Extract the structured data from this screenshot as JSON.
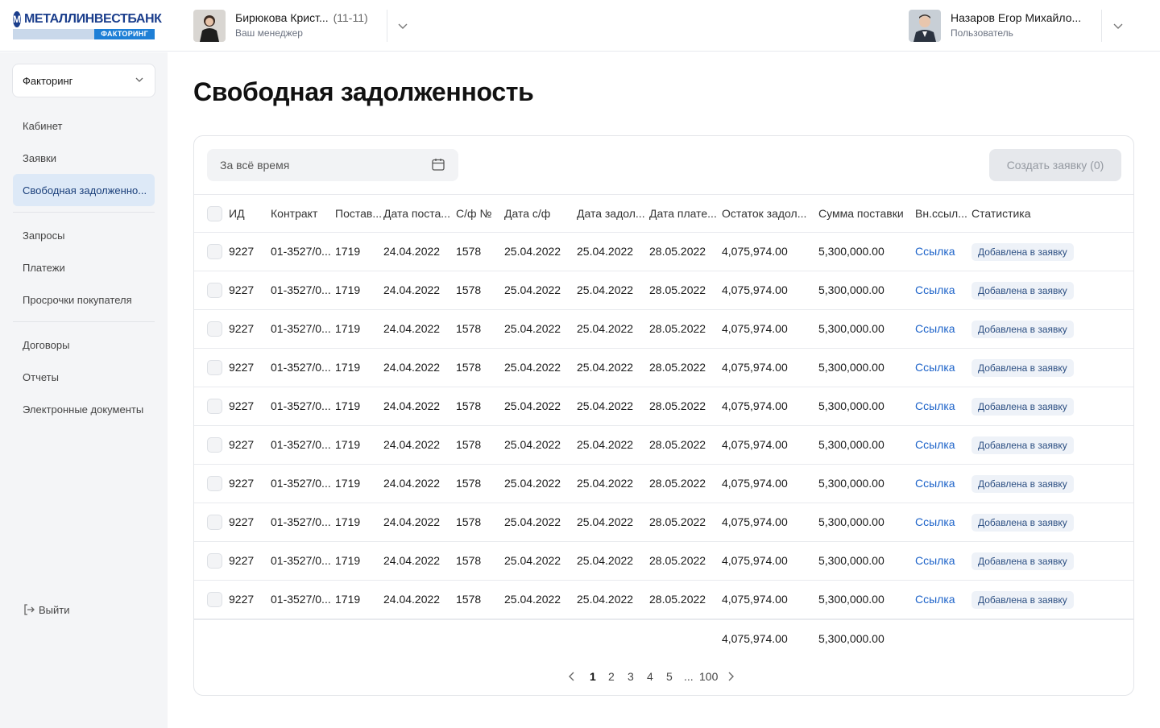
{
  "brand": {
    "name": "МЕТАЛЛИНВЕСТБАНК",
    "sub": "ФАКТОРИНГ",
    "mark": "М",
    "colors": {
      "primary": "#1b3e8c",
      "accent": "#1e7fd6",
      "active_bg": "#dde9f7",
      "link": "#1d63c9"
    }
  },
  "manager": {
    "name": "Бирюкова Крист...",
    "code": "(11-11)",
    "role": "Ваш менеджер"
  },
  "user": {
    "name": "Назаров Егор Михайло...",
    "role": "Пользователь"
  },
  "sidebar": {
    "product_select": "Факторинг",
    "items": [
      {
        "label": "Кабинет"
      },
      {
        "label": "Заявки"
      },
      {
        "label": "Свободная задолженно...",
        "active": true
      },
      {
        "label": "Запросы"
      },
      {
        "label": "Платежи"
      },
      {
        "label": "Просрочки покупателя"
      },
      {
        "label": "Договоры"
      },
      {
        "label": "Отчеты"
      },
      {
        "label": "Электронные документы"
      }
    ],
    "logout": "Выйти"
  },
  "page": {
    "title": "Свободная задолженность"
  },
  "filters": {
    "date_placeholder": "За всё время",
    "create_button": "Создать заявку (0)"
  },
  "table": {
    "headers": {
      "id": "ИД",
      "contract": "Контракт",
      "supplier": "Постав...",
      "delivery_date": "Дата поста...",
      "invoice_no": "С/ф №",
      "invoice_date": "Дата с/ф",
      "debt_date": "Дата задол...",
      "payment_date": "Дата плате...",
      "debt_balance": "Остаток задол...",
      "delivery_sum": "Сумма поставки",
      "ext_link": "Вн.ссыл...",
      "statistics": "Статистика"
    },
    "rows": [
      {
        "id": "9227",
        "contract": "01-3527/0...",
        "supplier": "1719",
        "delivery_date": "24.04.2022",
        "invoice_no": "1578",
        "invoice_date": "25.04.2022",
        "debt_date": "25.04.2022",
        "payment_date": "28.05.2022",
        "debt_balance": "4,075,974.00",
        "delivery_sum": "5,300,000.00",
        "ext_link": "Ссылка",
        "statistics": "Добавлена в заявку"
      },
      {
        "id": "9227",
        "contract": "01-3527/0...",
        "supplier": "1719",
        "delivery_date": "24.04.2022",
        "invoice_no": "1578",
        "invoice_date": "25.04.2022",
        "debt_date": "25.04.2022",
        "payment_date": "28.05.2022",
        "debt_balance": "4,075,974.00",
        "delivery_sum": "5,300,000.00",
        "ext_link": "Ссылка",
        "statistics": "Добавлена в заявку"
      },
      {
        "id": "9227",
        "contract": "01-3527/0...",
        "supplier": "1719",
        "delivery_date": "24.04.2022",
        "invoice_no": "1578",
        "invoice_date": "25.04.2022",
        "debt_date": "25.04.2022",
        "payment_date": "28.05.2022",
        "debt_balance": "4,075,974.00",
        "delivery_sum": "5,300,000.00",
        "ext_link": "Ссылка",
        "statistics": "Добавлена в заявку"
      },
      {
        "id": "9227",
        "contract": "01-3527/0...",
        "supplier": "1719",
        "delivery_date": "24.04.2022",
        "invoice_no": "1578",
        "invoice_date": "25.04.2022",
        "debt_date": "25.04.2022",
        "payment_date": "28.05.2022",
        "debt_balance": "4,075,974.00",
        "delivery_sum": "5,300,000.00",
        "ext_link": "Ссылка",
        "statistics": "Добавлена в заявку"
      },
      {
        "id": "9227",
        "contract": "01-3527/0...",
        "supplier": "1719",
        "delivery_date": "24.04.2022",
        "invoice_no": "1578",
        "invoice_date": "25.04.2022",
        "debt_date": "25.04.2022",
        "payment_date": "28.05.2022",
        "debt_balance": "4,075,974.00",
        "delivery_sum": "5,300,000.00",
        "ext_link": "Ссылка",
        "statistics": "Добавлена в заявку"
      },
      {
        "id": "9227",
        "contract": "01-3527/0...",
        "supplier": "1719",
        "delivery_date": "24.04.2022",
        "invoice_no": "1578",
        "invoice_date": "25.04.2022",
        "debt_date": "25.04.2022",
        "payment_date": "28.05.2022",
        "debt_balance": "4,075,974.00",
        "delivery_sum": "5,300,000.00",
        "ext_link": "Ссылка",
        "statistics": "Добавлена в заявку"
      },
      {
        "id": "9227",
        "contract": "01-3527/0...",
        "supplier": "1719",
        "delivery_date": "24.04.2022",
        "invoice_no": "1578",
        "invoice_date": "25.04.2022",
        "debt_date": "25.04.2022",
        "payment_date": "28.05.2022",
        "debt_balance": "4,075,974.00",
        "delivery_sum": "5,300,000.00",
        "ext_link": "Ссылка",
        "statistics": "Добавлена в заявку"
      },
      {
        "id": "9227",
        "contract": "01-3527/0...",
        "supplier": "1719",
        "delivery_date": "24.04.2022",
        "invoice_no": "1578",
        "invoice_date": "25.04.2022",
        "debt_date": "25.04.2022",
        "payment_date": "28.05.2022",
        "debt_balance": "4,075,974.00",
        "delivery_sum": "5,300,000.00",
        "ext_link": "Ссылка",
        "statistics": "Добавлена в заявку"
      },
      {
        "id": "9227",
        "contract": "01-3527/0...",
        "supplier": "1719",
        "delivery_date": "24.04.2022",
        "invoice_no": "1578",
        "invoice_date": "25.04.2022",
        "debt_date": "25.04.2022",
        "payment_date": "28.05.2022",
        "debt_balance": "4,075,974.00",
        "delivery_sum": "5,300,000.00",
        "ext_link": "Ссылка",
        "statistics": "Добавлена в заявку"
      },
      {
        "id": "9227",
        "contract": "01-3527/0...",
        "supplier": "1719",
        "delivery_date": "24.04.2022",
        "invoice_no": "1578",
        "invoice_date": "25.04.2022",
        "debt_date": "25.04.2022",
        "payment_date": "28.05.2022",
        "debt_balance": "4,075,974.00",
        "delivery_sum": "5,300,000.00",
        "ext_link": "Ссылка",
        "statistics": "Добавлена в заявку"
      }
    ],
    "totals": {
      "debt_balance": "4,075,974.00",
      "delivery_sum": "5,300,000.00"
    }
  },
  "pagination": {
    "pages": [
      "1",
      "2",
      "3",
      "4",
      "5"
    ],
    "current": "1",
    "ellipsis": "...",
    "last": "100"
  }
}
